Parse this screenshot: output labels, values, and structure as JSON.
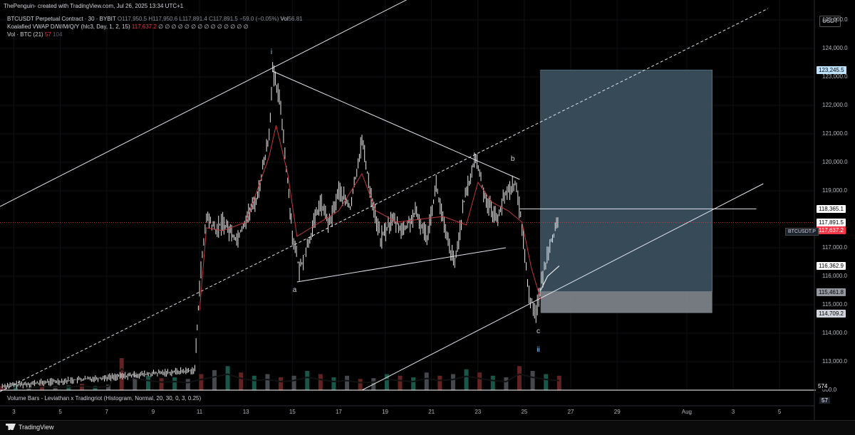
{
  "header": {
    "author_line": "ThePenguin- created with TradingView.com, Jul 26, 2025 13:34 UTC+1"
  },
  "legend": {
    "symbol": "BTCUSDT Perpetual Contract · 30 · BYBIT",
    "o_label": "O",
    "o_val": "117,950.5",
    "h_label": "H",
    "h_val": "117,950.6",
    "l_label": "L",
    "l_val": "117,891.4",
    "c_label": "C",
    "c_val": "117,891.5",
    "change": "−59.0 (−0.05%)",
    "vol_label": "Vol",
    "vol_val": "56.81",
    "vwap_name": "Koalafied VWAP D/W/M/Q/Y (hlc3, Day, 1, 2, 15)",
    "vwap_val": "117,637.2",
    "vwap_zeros": "∅ ∅ ∅ ∅ ∅ ∅ ∅ ∅ ∅ ∅ ∅ ∅ ∅ ∅",
    "volbtc_name": "Vol · BTC (21)",
    "volbtc_val": "57",
    "volbtc_val2": "104"
  },
  "currency_button": "USDT",
  "price_axis": [
    {
      "label": "125,000.0",
      "value": 125000
    },
    {
      "label": "124,000.0",
      "value": 124000
    },
    {
      "label": "123,000.0",
      "value": 123000
    },
    {
      "label": "122,000.0",
      "value": 122000
    },
    {
      "label": "121,000.0",
      "value": 121000
    },
    {
      "label": "120,000.0",
      "value": 120000
    },
    {
      "label": "119,000.0",
      "value": 119000
    },
    {
      "label": "117,000.0",
      "value": 117000
    },
    {
      "label": "116,000.0",
      "value": 116000
    },
    {
      "label": "115,000.0",
      "value": 115000
    },
    {
      "label": "114,000.0",
      "value": 114000
    },
    {
      "label": "113,000.0",
      "value": 113000
    },
    {
      "label": "000.0",
      "value": 112000
    }
  ],
  "price_labels": [
    {
      "label": "123,245.5",
      "value": 123245.5,
      "bg": "#bfe3ff",
      "fg": "#000000"
    },
    {
      "label": "118,365.1",
      "value": 118365.1,
      "bg": "#ffffff",
      "fg": "#000000"
    },
    {
      "label": "117,891.5",
      "value": 117891.5,
      "bg": "#ffffff",
      "fg": "#000000"
    },
    {
      "label": "25:42",
      "value": 117680,
      "bg": "#ffffff",
      "fg": "#000000"
    },
    {
      "label": "117,637.2",
      "value": 117637.2,
      "bg": "#f23645",
      "fg": "#ffffff"
    },
    {
      "label": "116,362.9",
      "value": 116362.9,
      "bg": "#ffffff",
      "fg": "#000000"
    },
    {
      "label": "115,461.8",
      "value": 115461.8,
      "bg": "#9598a1",
      "fg": "#000000"
    },
    {
      "label": "114,709.2",
      "value": 114709.2,
      "bg": "#d1d4dc",
      "fg": "#000000"
    }
  ],
  "symbol_tag": "BTCUSDT.P",
  "volume_574": "574",
  "time_axis": [
    {
      "label": "3",
      "day": 3
    },
    {
      "label": "5",
      "day": 5
    },
    {
      "label": "7",
      "day": 7
    },
    {
      "label": "9",
      "day": 9
    },
    {
      "label": "11",
      "day": 11
    },
    {
      "label": "13",
      "day": 13
    },
    {
      "label": "15",
      "day": 15
    },
    {
      "label": "17",
      "day": 17
    },
    {
      "label": "19",
      "day": 19
    },
    {
      "label": "21",
      "day": 21
    },
    {
      "label": "23",
      "day": 23
    },
    {
      "label": "25",
      "day": 25
    },
    {
      "label": "27",
      "day": 27
    },
    {
      "label": "29",
      "day": 29
    },
    {
      "label": "Aug",
      "day": 32
    },
    {
      "label": "3",
      "day": 34
    },
    {
      "label": "5",
      "day": 36
    }
  ],
  "wave_labels": [
    {
      "text": "i",
      "day": 14.1,
      "price": 123850,
      "blue": true
    },
    {
      "text": "a",
      "day": 15.1,
      "price": 115500,
      "blue": false
    },
    {
      "text": "b",
      "day": 24.5,
      "price": 120100,
      "blue": false
    },
    {
      "text": "c",
      "day": 25.6,
      "price": 114050,
      "blue": false
    },
    {
      "text": "ii",
      "day": 25.6,
      "price": 113400,
      "blue": true
    }
  ],
  "volume_pane": {
    "title": "Volume Bars - Leviathan x Tradingriot (Histogram, Normal, 20, 30, 0, 3, 0.25)",
    "value": "57"
  },
  "footer": {
    "brand": "TradingView"
  },
  "chart_data": {
    "type": "candlestick",
    "symbol": "BTCUSDT.P",
    "timeframe": "30",
    "exchange": "BYBIT",
    "xrange_days": [
      2.4,
      37.5
    ],
    "ylim": [
      112000,
      125700
    ],
    "price_path": [
      {
        "day": 2.5,
        "price": 112150
      },
      {
        "day": 10.8,
        "price": 112700
      },
      {
        "day": 11.0,
        "price": 115700
      },
      {
        "day": 11.3,
        "price": 118100
      },
      {
        "day": 11.7,
        "price": 117600
      },
      {
        "day": 12.0,
        "price": 117900
      },
      {
        "day": 12.6,
        "price": 117300
      },
      {
        "day": 13.0,
        "price": 118000
      },
      {
        "day": 13.5,
        "price": 118800
      },
      {
        "day": 14.0,
        "price": 121000
      },
      {
        "day": 14.15,
        "price": 123200
      },
      {
        "day": 14.5,
        "price": 122000
      },
      {
        "day": 14.8,
        "price": 119300
      },
      {
        "day": 15.0,
        "price": 117500
      },
      {
        "day": 15.3,
        "price": 116200
      },
      {
        "day": 15.7,
        "price": 117200
      },
      {
        "day": 16.2,
        "price": 118600
      },
      {
        "day": 16.6,
        "price": 117800
      },
      {
        "day": 17.0,
        "price": 119000
      },
      {
        "day": 17.5,
        "price": 118400
      },
      {
        "day": 18.0,
        "price": 120800
      },
      {
        "day": 18.4,
        "price": 118800
      },
      {
        "day": 18.8,
        "price": 117300
      },
      {
        "day": 19.3,
        "price": 118000
      },
      {
        "day": 19.8,
        "price": 117600
      },
      {
        "day": 20.3,
        "price": 118200
      },
      {
        "day": 20.8,
        "price": 117400
      },
      {
        "day": 21.2,
        "price": 119200
      },
      {
        "day": 21.6,
        "price": 117500
      },
      {
        "day": 22.0,
        "price": 116400
      },
      {
        "day": 22.4,
        "price": 118600
      },
      {
        "day": 22.9,
        "price": 120200
      },
      {
        "day": 23.3,
        "price": 118800
      },
      {
        "day": 23.8,
        "price": 118000
      },
      {
        "day": 24.2,
        "price": 118900
      },
      {
        "day": 24.6,
        "price": 119300
      },
      {
        "day": 24.9,
        "price": 117800
      },
      {
        "day": 25.2,
        "price": 115300
      },
      {
        "day": 25.5,
        "price": 114750
      },
      {
        "day": 25.8,
        "price": 116000
      },
      {
        "day": 26.1,
        "price": 117200
      },
      {
        "day": 26.5,
        "price": 117891.5
      }
    ],
    "vwap_path": [
      {
        "day": 11.0,
        "price": 114800
      },
      {
        "day": 11.3,
        "price": 117700
      },
      {
        "day": 12.0,
        "price": 117600
      },
      {
        "day": 13.0,
        "price": 117900
      },
      {
        "day": 14.0,
        "price": 120200
      },
      {
        "day": 14.3,
        "price": 121300
      },
      {
        "day": 14.8,
        "price": 119600
      },
      {
        "day": 15.2,
        "price": 117400
      },
      {
        "day": 16.0,
        "price": 117800
      },
      {
        "day": 17.0,
        "price": 118300
      },
      {
        "day": 18.0,
        "price": 119600
      },
      {
        "day": 18.6,
        "price": 118300
      },
      {
        "day": 19.5,
        "price": 117900
      },
      {
        "day": 20.5,
        "price": 118000
      },
      {
        "day": 21.5,
        "price": 118100
      },
      {
        "day": 22.5,
        "price": 117800
      },
      {
        "day": 23.0,
        "price": 119300
      },
      {
        "day": 23.6,
        "price": 118600
      },
      {
        "day": 24.3,
        "price": 118300
      },
      {
        "day": 24.9,
        "price": 117900
      },
      {
        "day": 25.3,
        "price": 116300
      },
      {
        "day": 25.7,
        "price": 115200
      }
    ],
    "white_vwap_path": [
      {
        "day": 25.7,
        "price": 115500
      },
      {
        "day": 26.0,
        "price": 116000
      },
      {
        "day": 26.5,
        "price": 116362.9
      }
    ],
    "trendlines": [
      {
        "name": "upper-channel",
        "from": {
          "day": 2.4,
          "price": 118450
        },
        "to": {
          "day": 21.6,
          "price": 126400
        },
        "style": "solid"
      },
      {
        "name": "mid-channel-dashed",
        "from": {
          "day": 2.4,
          "price": 111950
        },
        "to": {
          "day": 35.5,
          "price": 125400
        },
        "style": "dashed"
      },
      {
        "name": "lower-channel",
        "from": {
          "day": 18.0,
          "price": 112000
        },
        "to": {
          "day": 35.3,
          "price": 119250
        },
        "style": "solid"
      },
      {
        "name": "i-to-b",
        "from": {
          "day": 14.15,
          "price": 123200
        },
        "to": {
          "day": 24.8,
          "price": 119400
        },
        "style": "solid"
      },
      {
        "name": "a-to-c-base",
        "from": {
          "day": 15.2,
          "price": 115800
        },
        "to": {
          "day": 24.2,
          "price": 117000
        },
        "style": "solid"
      },
      {
        "name": "horizontal-resistance",
        "from": {
          "day": 24.8,
          "price": 118365.1
        },
        "to": {
          "day": 35.0,
          "price": 118365.1
        },
        "style": "solid"
      }
    ],
    "price_line": 117891.5,
    "position_box": {
      "from_day": 25.7,
      "to_day": 33.1,
      "target": 123245.5,
      "entry": 115461.8,
      "stop": 114709.2
    },
    "volume": {
      "values": [
        5,
        6,
        4,
        7,
        5,
        6,
        8,
        5,
        7,
        40,
        22,
        18,
        15,
        16,
        14,
        20,
        25,
        30,
        22,
        18,
        20,
        16,
        18,
        24,
        20,
        16,
        18,
        14,
        15,
        20,
        18,
        16,
        22,
        18,
        20,
        26,
        22,
        18,
        16,
        30,
        24,
        20,
        18
      ],
      "start_day": 2.5,
      "end_day": 26.5
    }
  }
}
